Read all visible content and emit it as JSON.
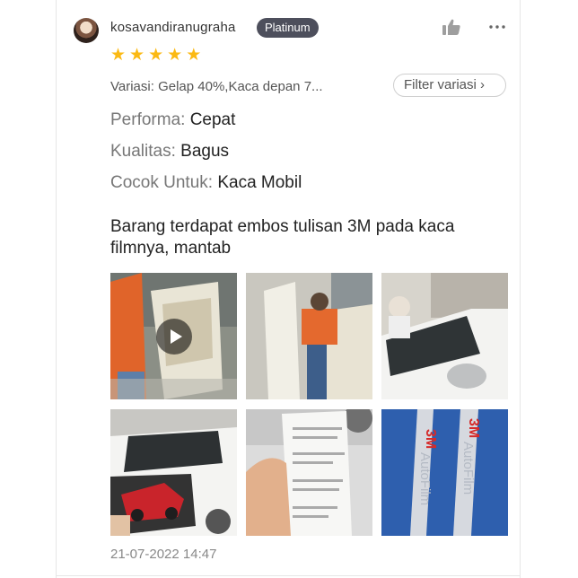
{
  "review": {
    "username": "kosavandiranugraha",
    "badge": "Platinum",
    "rating": 5,
    "variation": "Variasi: Gelap 40%,Kaca depan 7...",
    "filter_label": "Filter variasi",
    "filter_chevron": "›",
    "attributes": [
      {
        "key": "Performa:",
        "value": "Cepat"
      },
      {
        "key": "Kualitas:",
        "value": "Bagus"
      },
      {
        "key": "Cocok Untuk:",
        "value": "Kaca Mobil"
      }
    ],
    "text": "Barang terdapat embos tulisan 3M pada kaca filmnya, mantab",
    "media": [
      {
        "type": "video",
        "subject": "worker tinting car door window"
      },
      {
        "type": "image",
        "subject": "worker applying film to open car door"
      },
      {
        "type": "image",
        "subject": "white car with mirror and workshop"
      },
      {
        "type": "image",
        "subject": "white car door with red car sticker"
      },
      {
        "type": "image",
        "subject": "hand holding warranty document"
      },
      {
        "type": "image",
        "subject": "3M AutoFilm embossed film strips"
      }
    ],
    "timestamp": "21-07-2022 14:47"
  },
  "media_text": {
    "film_brand": "3M",
    "film_product": "AutoFilm"
  },
  "icons": {
    "like": "thumb-up-icon",
    "more": "more-options-icon",
    "star": "star-icon",
    "play": "play-icon"
  },
  "colors": {
    "star": "#fbb913",
    "badge_bg": "#4d4f5c",
    "text": "#222222",
    "muted": "#777777"
  }
}
